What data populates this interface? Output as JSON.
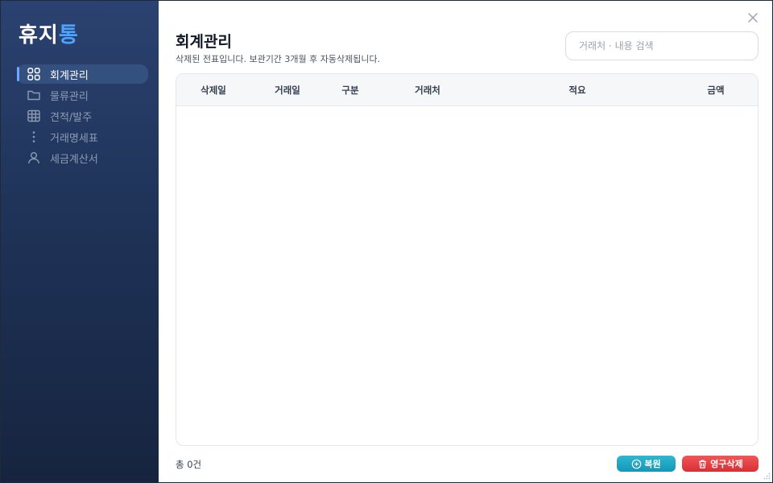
{
  "app": {
    "logo_part1": "휴지",
    "logo_part2": "통"
  },
  "colors": {
    "accent": "#4ea3ff",
    "restore": "#1fa8c4",
    "delete": "#e43f45",
    "sidebar_top": "#2b4270",
    "sidebar_bottom": "#16243f"
  },
  "sidebar": {
    "items": [
      {
        "label": "회계관리",
        "icon": "grid-icon",
        "active": true
      },
      {
        "label": "물류관리",
        "icon": "folder-icon",
        "active": false
      },
      {
        "label": "견적/발주",
        "icon": "table-icon",
        "active": false
      },
      {
        "label": "거래명세표",
        "icon": "more-vertical-icon",
        "active": false
      },
      {
        "label": "세금계산서",
        "icon": "user-icon",
        "active": false
      }
    ]
  },
  "header": {
    "title": "회계관리",
    "description": "삭제된 전표입니다. 보관기간 3개월 후 자동삭제됩니다."
  },
  "search": {
    "placeholder": "거래처 · 내용 검색",
    "value": ""
  },
  "table": {
    "columns": [
      "삭제일",
      "거래일",
      "구분",
      "거래처",
      "적요",
      "금액"
    ],
    "rows": []
  },
  "footer": {
    "total": "총 0건",
    "restore_label": "복원",
    "delete_label": "영구삭제"
  }
}
